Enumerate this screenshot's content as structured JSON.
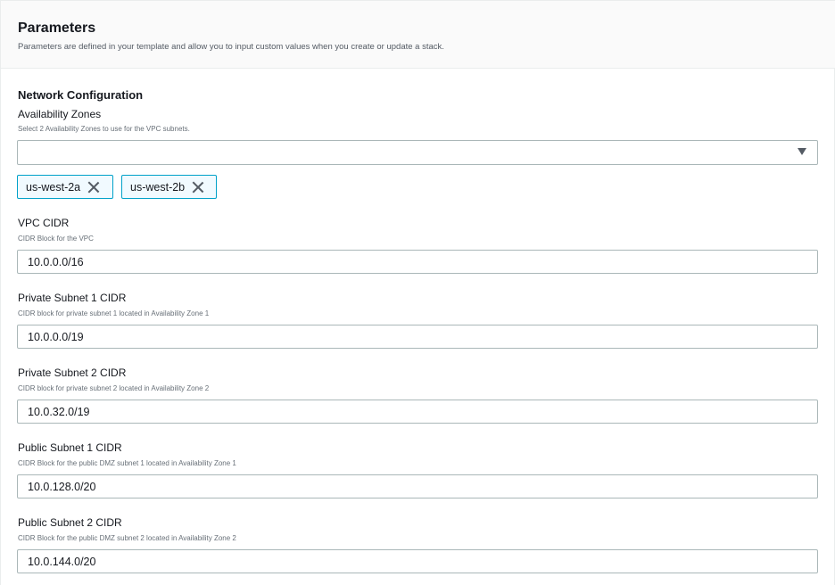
{
  "header": {
    "title": "Parameters",
    "description": "Parameters are defined in your template and allow you to input custom values when you create or update a stack."
  },
  "section": {
    "title": "Network Configuration"
  },
  "availability_zones": {
    "label": "Availability Zones",
    "description": "Select 2 Availability Zones to use for the VPC subnets.",
    "selected_value": "",
    "tokens": [
      "us-west-2a",
      "us-west-2b"
    ]
  },
  "fields": [
    {
      "label": "VPC CIDR",
      "description": "CIDR Block for the VPC",
      "value": "10.0.0.0/16"
    },
    {
      "label": "Private Subnet 1 CIDR",
      "description": "CIDR block for private subnet 1 located in Availability Zone 1",
      "value": "10.0.0.0/19"
    },
    {
      "label": "Private Subnet 2 CIDR",
      "description": "CIDR block for private subnet 2 located in Availability Zone 2",
      "value": "10.0.32.0/19"
    },
    {
      "label": "Public Subnet 1 CIDR",
      "description": "CIDR Block for the public DMZ subnet 1 located in Availability Zone 1",
      "value": "10.0.128.0/20"
    },
    {
      "label": "Public Subnet 2 CIDR",
      "description": "CIDR Block for the public DMZ subnet 2 located in Availability Zone 2",
      "value": "10.0.144.0/20"
    }
  ],
  "icons": {
    "dropdown": "caret-down-icon",
    "remove_token": "close-icon"
  },
  "colors": {
    "token_border": "#00a1c9",
    "input_border": "#aab7b8",
    "header_bg": "#fafafa"
  }
}
